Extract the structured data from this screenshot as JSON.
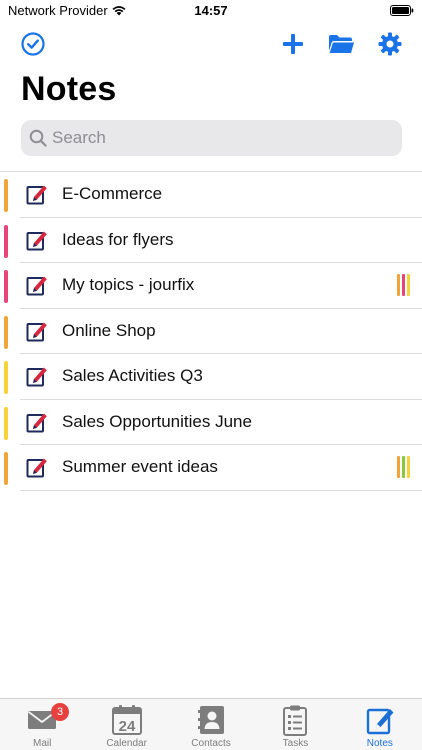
{
  "status_bar": {
    "carrier": "Network Provider",
    "time": "14:57"
  },
  "toolbar": {
    "icons": [
      "checkmark-circle-icon",
      "plus-icon",
      "folder-icon",
      "gear-icon"
    ],
    "accent_color": "#1a73e8"
  },
  "page": {
    "title": "Notes"
  },
  "search": {
    "placeholder": "Search",
    "value": ""
  },
  "notes": [
    {
      "title": "E-Commerce",
      "color": "#f0a53a",
      "tags": []
    },
    {
      "title": "Ideas for flyers",
      "color": "#e6457a",
      "tags": []
    },
    {
      "title": "My topics - jourfix",
      "color": "#e6457a",
      "tags": [
        "#f0a53a",
        "#e6457a",
        "#f7d23a"
      ]
    },
    {
      "title": "Online Shop",
      "color": "#f0a53a",
      "tags": []
    },
    {
      "title": "Sales Activities Q3",
      "color": "#f7d23a",
      "tags": []
    },
    {
      "title": "Sales Opportunities June",
      "color": "#f7d23a",
      "tags": []
    },
    {
      "title": "Summer event ideas",
      "color": "#f0a53a",
      "tags": [
        "#f0a53a",
        "#8cc63f",
        "#f7d23a"
      ]
    }
  ],
  "tab_bar": {
    "tabs": [
      {
        "label": "Mail",
        "icon": "mail-icon",
        "badge": "3",
        "active": false
      },
      {
        "label": "Calendar",
        "icon": "calendar-icon",
        "badge": "",
        "active": false,
        "icon_text": "24"
      },
      {
        "label": "Contacts",
        "icon": "contacts-icon",
        "badge": "",
        "active": false
      },
      {
        "label": "Tasks",
        "icon": "tasks-icon",
        "badge": "",
        "active": false
      },
      {
        "label": "Notes",
        "icon": "notes-icon",
        "badge": "",
        "active": true
      }
    ],
    "active_color": "#1d6fd8",
    "inactive_color": "#7d7d7d"
  }
}
